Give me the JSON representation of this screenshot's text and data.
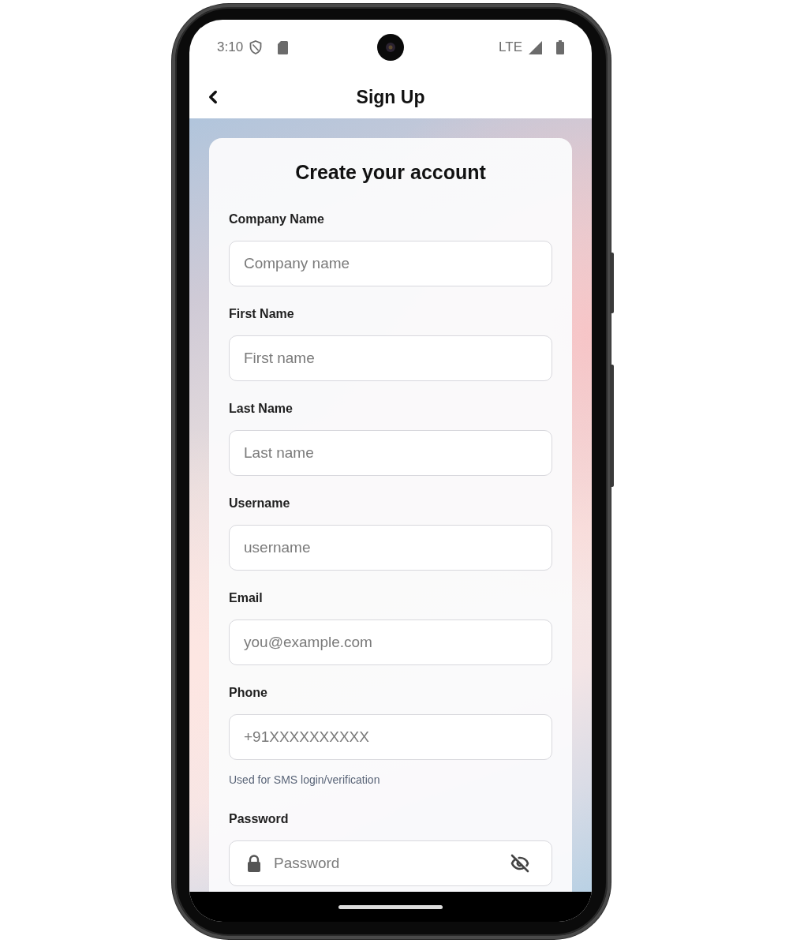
{
  "status_bar": {
    "time": "3:10",
    "network": "LTE"
  },
  "header": {
    "title": "Sign Up"
  },
  "form": {
    "title": "Create your account",
    "fields": [
      {
        "kind": "text",
        "label": "Company Name",
        "placeholder": "Company name"
      },
      {
        "kind": "text",
        "label": "First Name",
        "placeholder": "First name"
      },
      {
        "kind": "text",
        "label": "Last Name",
        "placeholder": "Last name"
      },
      {
        "kind": "text",
        "label": "Username",
        "placeholder": "username"
      },
      {
        "kind": "text",
        "label": "Email",
        "placeholder": "you@example.com"
      },
      {
        "kind": "text",
        "label": "Phone",
        "placeholder": "+91XXXXXXXXXX",
        "helper": "Used for SMS login/verification"
      },
      {
        "kind": "password",
        "label": "Password",
        "placeholder": "Password",
        "visible": false
      }
    ]
  }
}
